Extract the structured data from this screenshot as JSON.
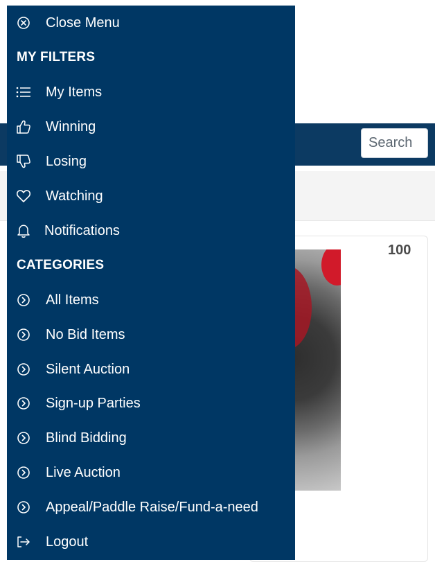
{
  "drawer": {
    "close_label": "Close Menu",
    "my_filters_heading": "MY FILTERS",
    "my_filters": [
      {
        "label": "My Items",
        "icon": "list-icon"
      },
      {
        "label": "Winning",
        "icon": "thumbs-up-icon"
      },
      {
        "label": "Losing",
        "icon": "thumbs-down-icon"
      },
      {
        "label": "Watching",
        "icon": "heart-icon"
      },
      {
        "label": "Notifications",
        "icon": "bell-icon"
      }
    ],
    "categories_heading": "CATEGORIES",
    "categories": [
      {
        "label": "All Items",
        "icon": "chevron-circle-right-icon"
      },
      {
        "label": "No Bid Items",
        "icon": "chevron-circle-right-icon"
      },
      {
        "label": "Silent Auction",
        "icon": "chevron-circle-right-icon"
      },
      {
        "label": "Sign-up Parties",
        "icon": "chevron-circle-right-icon"
      },
      {
        "label": "Blind Bidding",
        "icon": "chevron-circle-right-icon"
      },
      {
        "label": "Live Auction",
        "icon": "chevron-circle-right-icon"
      },
      {
        "label": "Appeal/Paddle Raise/Fund-a-need",
        "icon": "chevron-circle-right-icon"
      }
    ],
    "logout_label": "Logout"
  },
  "background": {
    "search_label": "Search",
    "card_number": "100"
  },
  "colors": {
    "drawer_bg": "#003764",
    "header_bg": "#0c3a62",
    "text": "#ffffff"
  }
}
